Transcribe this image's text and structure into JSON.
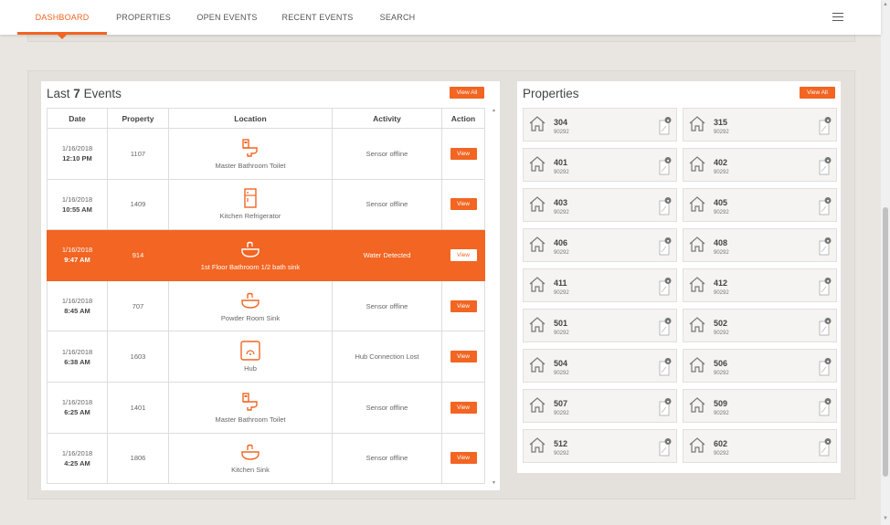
{
  "nav": {
    "tabs": [
      {
        "label": "DASHBOARD",
        "active": true
      },
      {
        "label": "PROPERTIES",
        "active": false
      },
      {
        "label": "OPEN EVENTS",
        "active": false
      },
      {
        "label": "RECENT EVENTS",
        "active": false
      },
      {
        "label": "SEARCH",
        "active": false
      }
    ],
    "menu_icon": "hamburger-icon"
  },
  "colors": {
    "accent": "#f26522",
    "background": "#e9e6e2",
    "card": "#ffffff",
    "tile": "#f5f4f2"
  },
  "events": {
    "title_prefix": "Last",
    "count": "7",
    "title_suffix": "Events",
    "view_all": "View All",
    "columns": [
      "Date",
      "Property",
      "Location",
      "Activity",
      "Action"
    ],
    "rows": [
      {
        "date": "1/16/2018",
        "time": "12:10 PM",
        "property": "1107",
        "location": "Master Bathroom Toilet",
        "icon": "toilet-icon",
        "activity": "Sensor offline",
        "action": "View",
        "highlighted": false
      },
      {
        "date": "1/16/2018",
        "time": "10:55 AM",
        "property": "1409",
        "location": "Kitchen Refrigerator",
        "icon": "refrigerator-icon",
        "activity": "Sensor offline",
        "action": "View",
        "highlighted": false
      },
      {
        "date": "1/16/2018",
        "time": "9:47 AM",
        "property": "914",
        "location": "1st Floor Bathroom 1/2 bath sink",
        "icon": "sink-icon",
        "activity": "Water Detected",
        "action": "View",
        "highlighted": true
      },
      {
        "date": "1/16/2018",
        "time": "8:45 AM",
        "property": "707",
        "location": "Powder Room Sink",
        "icon": "sink-icon",
        "activity": "Sensor offline",
        "action": "View",
        "highlighted": false
      },
      {
        "date": "1/16/2018",
        "time": "6:38 AM",
        "property": "1603",
        "location": "Hub",
        "icon": "hub-icon",
        "activity": "Hub Connection Lost",
        "action": "View",
        "highlighted": false
      },
      {
        "date": "1/16/2018",
        "time": "6:25 AM",
        "property": "1401",
        "location": "Master Bathroom Toilet",
        "icon": "toilet-icon",
        "activity": "Sensor offline",
        "action": "View",
        "highlighted": false
      },
      {
        "date": "1/16/2018",
        "time": "4:25 AM",
        "property": "1806",
        "location": "Kitchen Sink",
        "icon": "sink-icon",
        "activity": "Sensor offline",
        "action": "View",
        "highlighted": false
      }
    ]
  },
  "properties": {
    "title": "Properties",
    "view_all": "View All",
    "items": [
      {
        "number": "304",
        "zip": "90292"
      },
      {
        "number": "315",
        "zip": "90292"
      },
      {
        "number": "401",
        "zip": "90292"
      },
      {
        "number": "402",
        "zip": "90292"
      },
      {
        "number": "403",
        "zip": "90292"
      },
      {
        "number": "405",
        "zip": "90292"
      },
      {
        "number": "406",
        "zip": "90292"
      },
      {
        "number": "408",
        "zip": "90292"
      },
      {
        "number": "411",
        "zip": "90292"
      },
      {
        "number": "412",
        "zip": "90292"
      },
      {
        "number": "501",
        "zip": "90292"
      },
      {
        "number": "502",
        "zip": "90292"
      },
      {
        "number": "504",
        "zip": "90292"
      },
      {
        "number": "506",
        "zip": "90292"
      },
      {
        "number": "507",
        "zip": "90292"
      },
      {
        "number": "509",
        "zip": "90292"
      },
      {
        "number": "512",
        "zip": "90292"
      },
      {
        "number": "602",
        "zip": "90292"
      }
    ]
  }
}
